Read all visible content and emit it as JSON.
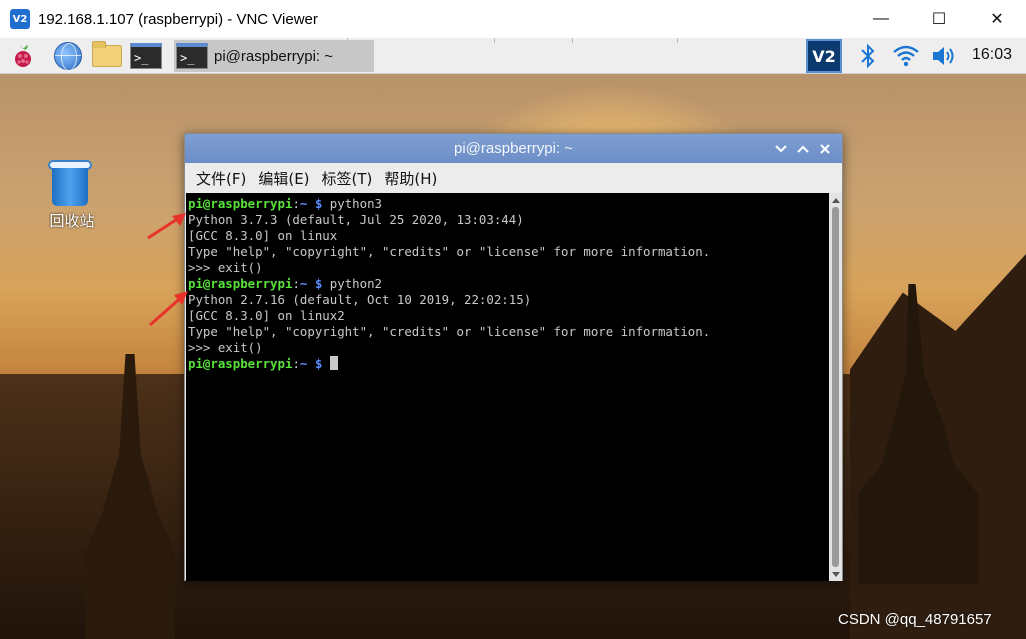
{
  "vnc": {
    "logo_text": "V2",
    "title": "192.168.1.107 (raspberrypi) - VNC Viewer",
    "minimize_label": "—",
    "maximize_label": "☐",
    "close_label": "✕"
  },
  "taskbar": {
    "terminal_icon_text": ">_",
    "task_label": "pi@raspberrypi: ~",
    "vnc_tray_text": "V2",
    "clock": "16:03"
  },
  "desktop": {
    "trash_label": "回收站",
    "watermark": "CSDN @qq_48791657"
  },
  "terminal": {
    "title": "pi@raspberrypi: ~",
    "menu": [
      "文件(F)",
      "编辑(E)",
      "标签(T)",
      "帮助(H)"
    ],
    "prompt_user": "pi@raspberrypi",
    "prompt_colon": ":",
    "prompt_tilde": "~",
    "prompt_dollar": "$",
    "cmd1": " python3",
    "out1_1": "Python 3.7.3 (default, Jul 25 2020, 13:03:44)",
    "out1_2": "[GCC 8.3.0] on linux",
    "out1_3": "Type \"help\", \"copyright\", \"credits\" or \"license\" for more information.",
    "out1_4": ">>> exit()",
    "cmd2": " python2",
    "out2_1": "Python 2.7.16 (default, Oct 10 2019, 22:02:15)",
    "out2_2": "[GCC 8.3.0] on linux2",
    "out2_3": "Type \"help\", \"copyright\", \"credits\" or \"license\" for more information.",
    "out2_4": ">>> exit()"
  },
  "colors": {
    "prompt_user": "#58e23a",
    "prompt_path": "#5b8cff",
    "annotation_arrow": "#e8322a"
  }
}
